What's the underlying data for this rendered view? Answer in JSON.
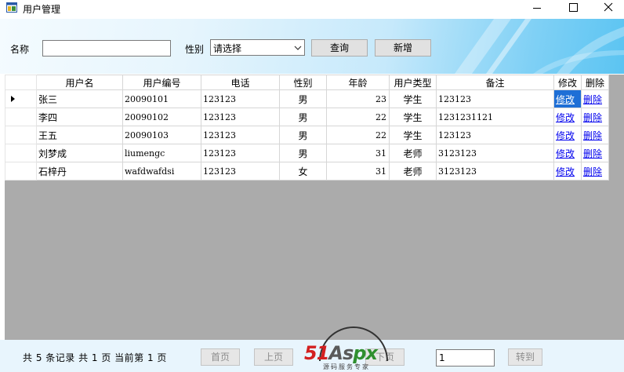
{
  "window": {
    "title": "用户管理",
    "controls": [
      "minimize-icon",
      "maximize-icon",
      "close-icon"
    ]
  },
  "search": {
    "name_label": "名称",
    "name_value": "",
    "gender_label": "性别",
    "gender_selected": "请选择",
    "query_label": "查询",
    "add_label": "新增"
  },
  "grid": {
    "columns": [
      "用户名",
      "用户编号",
      "电话",
      "性别",
      "年龄",
      "用户类型",
      "备注",
      "修改",
      "删除"
    ],
    "rows": [
      {
        "name": "张三",
        "id": "20090101",
        "phone": "123123",
        "gender": "男",
        "age": "23",
        "type": "学生",
        "note": "123123",
        "edit": "修改",
        "delete": "删除"
      },
      {
        "name": "李四",
        "id": "20090102",
        "phone": "123123",
        "gender": "男",
        "age": "22",
        "type": "学生",
        "note": "1231231121",
        "edit": "修改",
        "delete": "删除"
      },
      {
        "name": "王五",
        "id": "20090103",
        "phone": "123123",
        "gender": "男",
        "age": "22",
        "type": "学生",
        "note": "123123",
        "edit": "修改",
        "delete": "删除"
      },
      {
        "name": "刘梦成",
        "id": "liumengc",
        "phone": "123123",
        "gender": "男",
        "age": "31",
        "type": "老师",
        "note": "3123123",
        "edit": "修改",
        "delete": "删除"
      },
      {
        "name": "石梓丹",
        "id": "wafdwafdsi",
        "phone": "123123",
        "gender": "女",
        "age": "31",
        "type": "老师",
        "note": "3123123",
        "edit": "修改",
        "delete": "删除"
      }
    ]
  },
  "footer": {
    "record_info": "共 5 条记录  共 1 页  当前第 1 页",
    "first_label": "首页",
    "prev_label": "上页",
    "next_label": "下页",
    "page_value": "1",
    "goto_label": "转到"
  },
  "watermark": {
    "brand_part1": "51",
    "brand_part2": "As",
    "brand_part3": "px",
    "subtitle": "源码服务专家"
  },
  "colors": {
    "selection": "#1e6fd6",
    "grid_background": "#ababab",
    "banner_accent": "#5bc4f2",
    "link": "#0000ee"
  }
}
